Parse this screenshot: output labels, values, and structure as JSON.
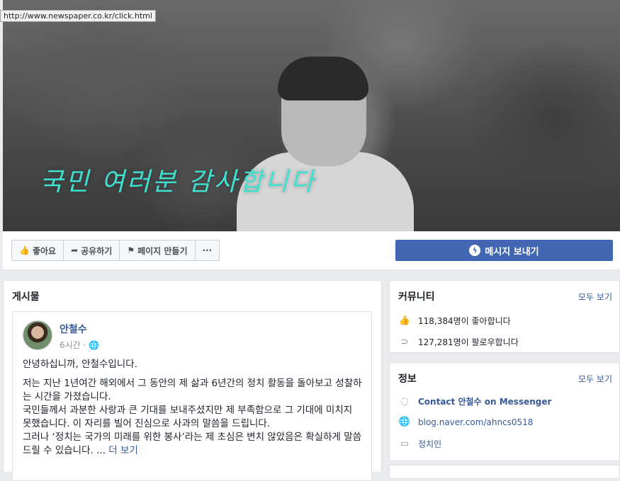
{
  "tooltip_url": "http://www.newspaper.co.kr/click.html",
  "cover": {
    "slogan": "국민 여러분 감사합니다"
  },
  "actions": {
    "like": "좋아요",
    "share": "공유하기",
    "create_page": "페이지 만들기",
    "more": "···",
    "message": "메시지 보내기"
  },
  "posts": {
    "title": "게시물",
    "post": {
      "author": "안철수",
      "time": "6시간 · ",
      "lines": [
        "안녕하십니까, 안철수입니다.",
        "저는 지난 1년여간 해외에서 그 동안의 제 삶과 6년간의 정치 활동을 돌아보고 성찰하는 시간을 가졌습니다.",
        "국민들께서 과분한 사랑과 큰 기대를 보내주셨지만 제 부족함으로 그 기대에 미치지 못했습니다. 이 자리를 빌어 진심으로 사과의 말씀을 드립니다.",
        "그러나 ‘정치는 국가의 미래를 위한 봉사’라는 제 초심은 변치 않았음은 확실하게 말씀드릴 수 있습니다. ..."
      ],
      "more_link": "더 보기"
    }
  },
  "community": {
    "title": "커뮤니티",
    "see_all": "모두 보기",
    "likes": "118,384명이 좋아합니다",
    "follows": "127,281명이 팔로우합니다"
  },
  "info": {
    "title": "정보",
    "see_all": "모두 보기",
    "messenger": "Contact 안철수 on Messenger",
    "website": "blog.naver.com/ahncs0518",
    "category": "정치인"
  }
}
